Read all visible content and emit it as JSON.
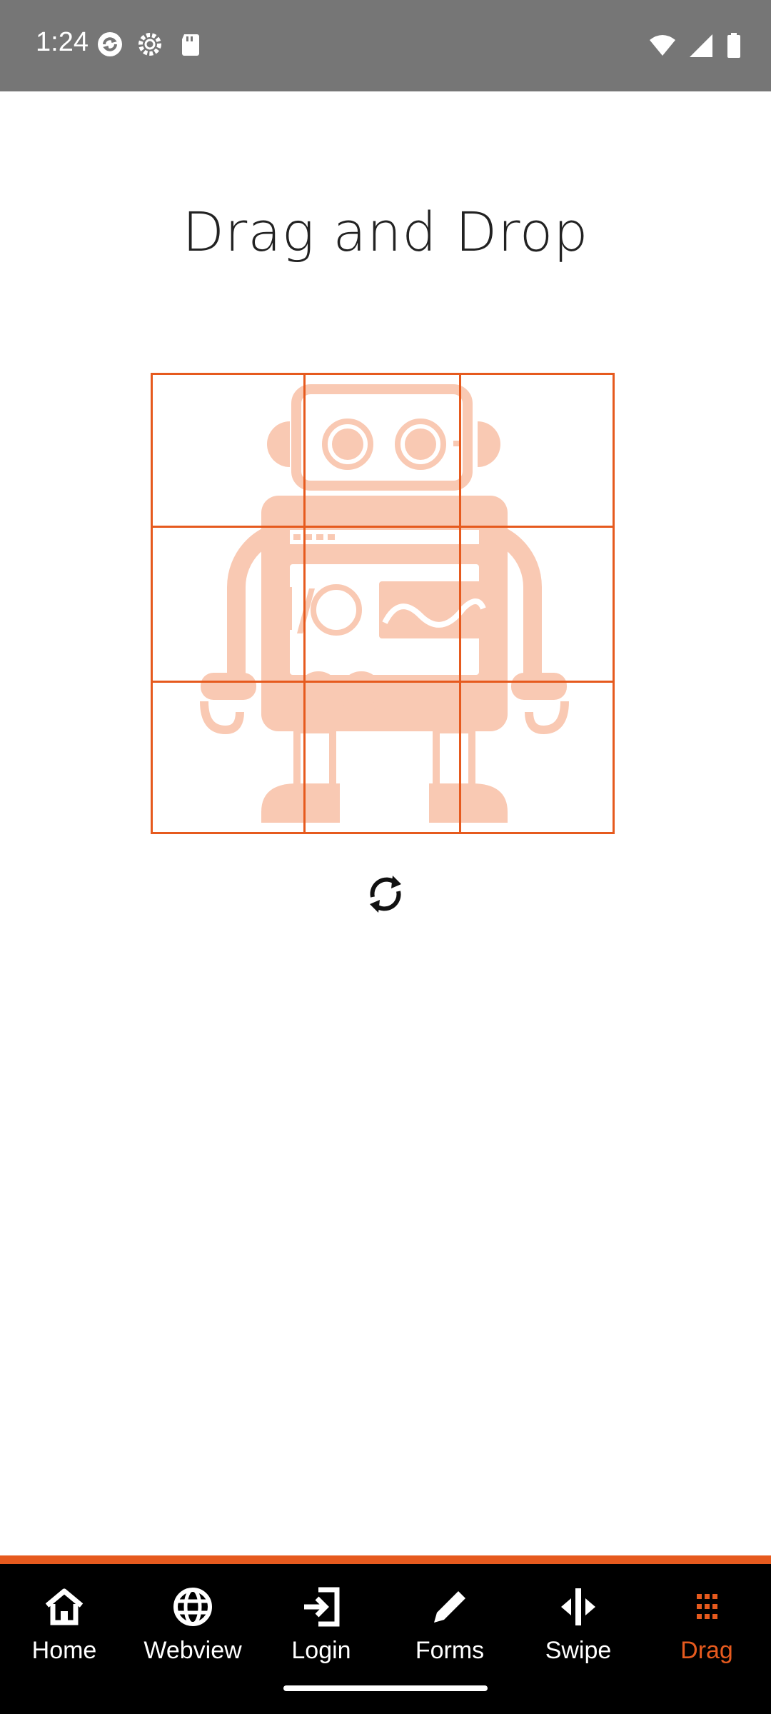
{
  "status_bar": {
    "time": "1:24",
    "icons_left": [
      "sync-icon",
      "settings-icon",
      "sd-card-icon"
    ],
    "icons_right": [
      "wifi-icon",
      "signal-icon",
      "battery-icon"
    ]
  },
  "page": {
    "title": "Drag and Drop"
  },
  "puzzle": {
    "rows": 3,
    "cols": 3,
    "image": "robot-icon",
    "accent_color": "#e65a1e",
    "image_color": "#f9c9b3"
  },
  "controls": {
    "reset_icon": "refresh-icon"
  },
  "tab_bar": {
    "items": [
      {
        "label": "Home",
        "icon": "home-icon",
        "active": false
      },
      {
        "label": "Webview",
        "icon": "globe-icon",
        "active": false
      },
      {
        "label": "Login",
        "icon": "login-icon",
        "active": false
      },
      {
        "label": "Forms",
        "icon": "pencil-icon",
        "active": false
      },
      {
        "label": "Swipe",
        "icon": "swipe-icon",
        "active": false
      },
      {
        "label": "Drag",
        "icon": "grid-dots-icon",
        "active": true
      }
    ]
  }
}
